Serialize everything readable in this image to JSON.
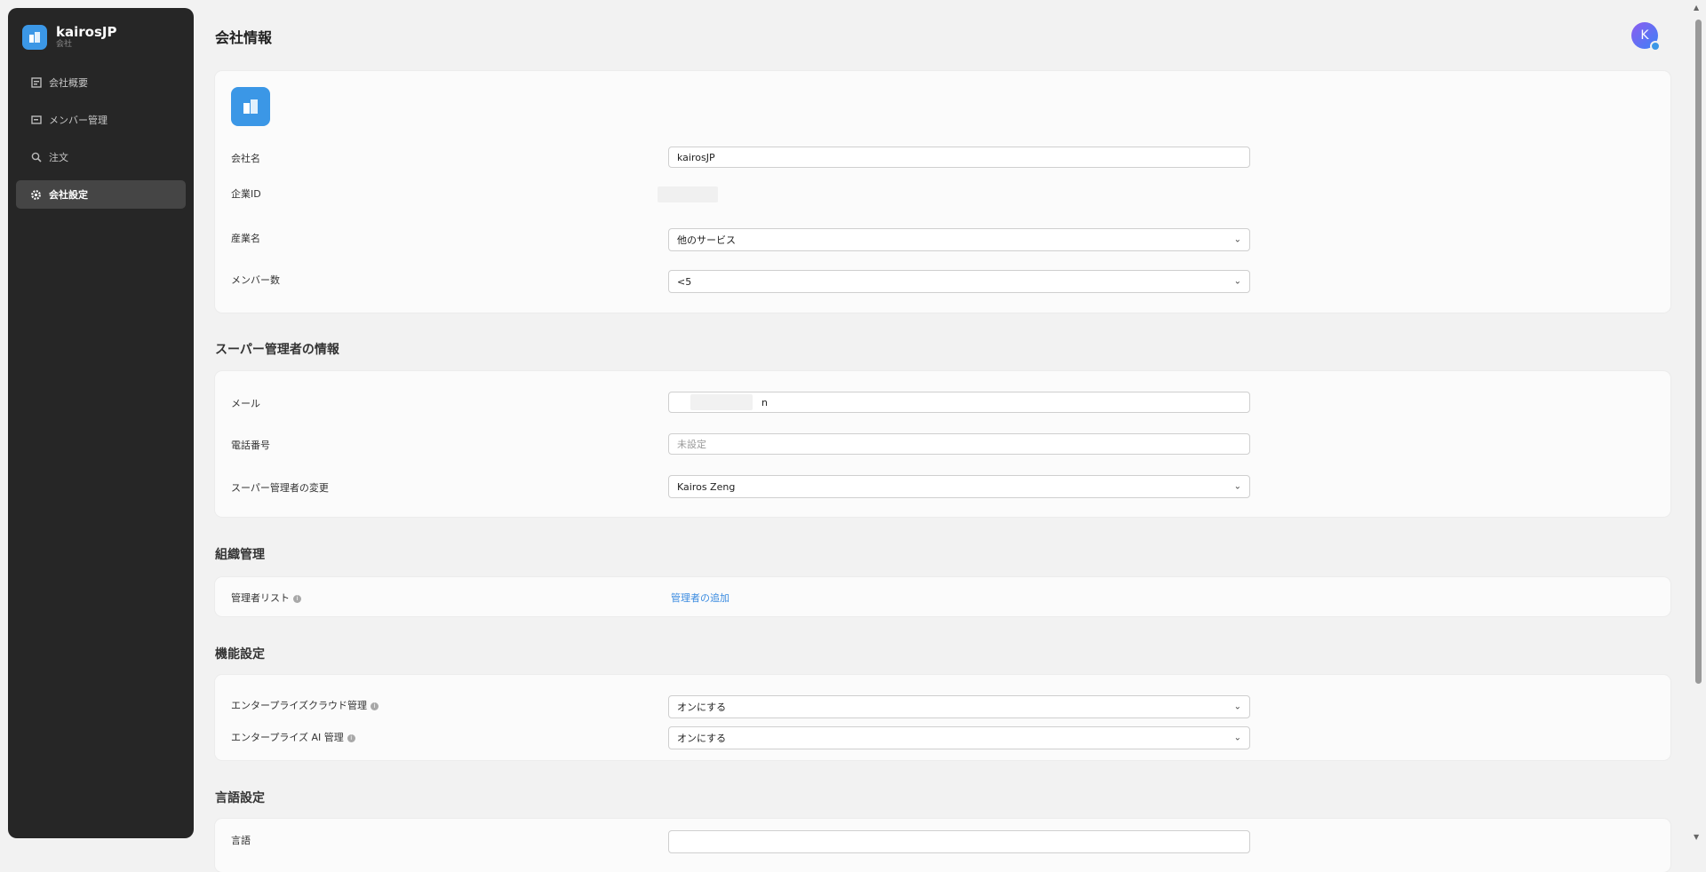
{
  "brand": {
    "name": "kairosJP",
    "sub": "会社"
  },
  "nav": [
    {
      "label": "会社概要",
      "icon": "overview-icon"
    },
    {
      "label": "メンバー管理",
      "icon": "members-icon"
    },
    {
      "label": "注文",
      "icon": "order-icon"
    },
    {
      "label": "会社設定",
      "icon": "gear-icon",
      "active": true
    }
  ],
  "page": {
    "title": "会社情報"
  },
  "user": {
    "avatar_letter": "K"
  },
  "company": {
    "name_label": "会社名",
    "name_value": "kairosJP",
    "id_label": "企業ID",
    "industry_label": "産業名",
    "industry_value": "他のサービス",
    "members_label": "メンバー数",
    "members_value": "<5"
  },
  "super_admin": {
    "title": "スーパー管理者の情報",
    "email_label": "メール",
    "email_visible_suffix": "n",
    "phone_label": "電話番号",
    "phone_placeholder": "未設定",
    "change_label": "スーパー管理者の変更",
    "change_value": "Kairos Zeng"
  },
  "org": {
    "title": "組織管理",
    "admin_list_label": "管理者リスト",
    "add_admin_link": "管理者の追加"
  },
  "features": {
    "title": "機能設定",
    "cloud_label": "エンタープライズクラウド管理",
    "cloud_value": "オンにする",
    "ai_label": "エンタープライズ AI 管理",
    "ai_value": "オンにする"
  },
  "language": {
    "title": "言語設定",
    "label": "言語"
  },
  "colors": {
    "accent": "#3b97e6",
    "sidebar": "#262626",
    "link": "#3b8be0"
  }
}
